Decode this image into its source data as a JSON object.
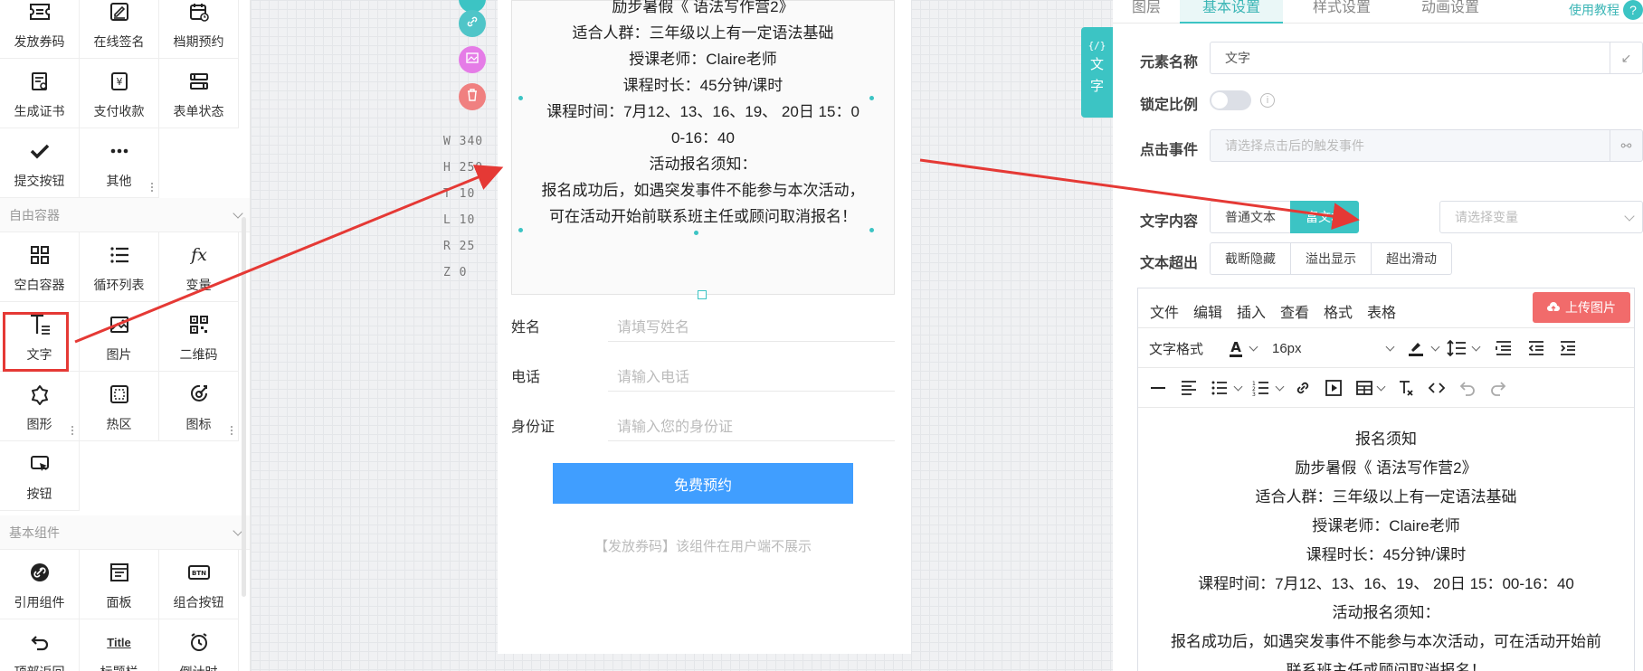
{
  "left_panel": {
    "items_top": [
      {
        "label": "发放券码",
        "icon": "coupon-icon"
      },
      {
        "label": "在线签名",
        "icon": "signature-icon"
      },
      {
        "label": "档期预约",
        "icon": "calendar-icon"
      },
      {
        "label": "生成证书",
        "icon": "certificate-icon"
      },
      {
        "label": "支付收款",
        "icon": "payment-icon"
      },
      {
        "label": "表单状态",
        "icon": "form-status-icon"
      },
      {
        "label": "提交按钮",
        "icon": "check-icon"
      },
      {
        "label": "其他",
        "icon": "more-icon"
      }
    ],
    "section_free": "自由容器",
    "items_free": [
      {
        "label": "空白容器",
        "icon": "blank-container-icon"
      },
      {
        "label": "循环列表",
        "icon": "loop-list-icon"
      },
      {
        "label": "变量",
        "icon": "fx-icon"
      },
      {
        "label": "文字",
        "icon": "text-icon"
      },
      {
        "label": "图片",
        "icon": "image-icon"
      },
      {
        "label": "二维码",
        "icon": "qrcode-icon"
      },
      {
        "label": "图形",
        "icon": "shape-icon"
      },
      {
        "label": "热区",
        "icon": "hotspot-icon"
      },
      {
        "label": "图标",
        "icon": "target-icon"
      },
      {
        "label": "按钮",
        "icon": "button-icon"
      }
    ],
    "section_basic": "基本组件",
    "items_basic": [
      {
        "label": "引用组件",
        "icon": "link-component-icon"
      },
      {
        "label": "面板",
        "icon": "panel-icon"
      },
      {
        "label": "组合按钮",
        "icon": "combo-button-icon"
      },
      {
        "label": "顶部返回",
        "icon": "back-icon"
      },
      {
        "label": "标题栏",
        "icon": "title-bar-icon",
        "glyph": "Title"
      },
      {
        "label": "倒计时",
        "icon": "alarm-icon"
      }
    ]
  },
  "canvas": {
    "meta": [
      "W 340",
      "H 250",
      "T 10",
      "L 10",
      "R 25",
      "Z 0"
    ],
    "text_lines": [
      "励步暑假《 语法写作营2》",
      "适合人群：三年级以上有一定语法基础",
      "授课老师：Claire老师",
      "课程时长：45分钟/课时",
      "课程时间：7月12、13、16、19、 20日   15：0",
      "0-16：40",
      "活动报名须知：",
      "报名成功后，如遇突发事件不能参与本次活动，",
      "可在活动开始前联系班主任或顾问取消报名！"
    ],
    "form": [
      {
        "label": "姓名",
        "placeholder": "请填写姓名"
      },
      {
        "label": "电话",
        "placeholder": "请输入电话"
      },
      {
        "label": "身份证",
        "placeholder": "请输入您的身份证"
      }
    ],
    "submit_label": "免费预约",
    "coupon_note": "【发放券码】该组件在用户端不展示"
  },
  "right_panel": {
    "side_tab": {
      "code": "{/}",
      "label_1": "文",
      "label_2": "字"
    },
    "tabs": [
      "图层",
      "基本设置",
      "样式设置",
      "动画设置"
    ],
    "active_tab": "基本设置",
    "help": "使用教程",
    "element_name_label": "元素名称",
    "element_name_value": "文字",
    "lock_ratio_label": "锁定比例",
    "click_event_label": "点击事件",
    "click_event_placeholder": "请选择点击后的触发事件",
    "text_content_label": "文字内容",
    "text_modes": [
      "普通文本",
      "富文本"
    ],
    "active_mode": "富文本",
    "variable_placeholder": "请选择变量",
    "overflow_label": "文本超出",
    "overflow_modes": [
      "截断隐藏",
      "溢出显示",
      "超出滑动"
    ],
    "editor": {
      "menus": [
        "文件",
        "编辑",
        "插入",
        "查看",
        "格式",
        "表格"
      ],
      "upload_label": "上传图片",
      "format_label": "文字格式",
      "font_size": "16px",
      "content": [
        "报名须知",
        "励步暑假《 语法写作营2》",
        "适合人群：三年级以上有一定语法基础",
        "授课老师：Claire老师",
        "课程时长：45分钟/课时",
        "课程时间：7月12、13、16、19、 20日   15：00-16：40",
        "活动报名须知：",
        "报名成功后，如遇突发事件不能参与本次活动，可在活动开始前",
        "联系班主任或顾问取消报名！"
      ]
    }
  },
  "colors": {
    "accent": "#3cc4c4",
    "primary_button": "#409eff",
    "annotation": "#e53935",
    "upload": "#f16b6b"
  }
}
